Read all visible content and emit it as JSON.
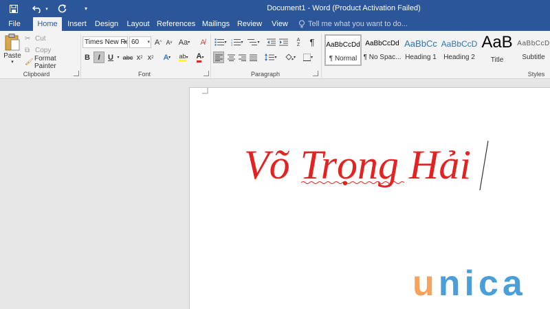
{
  "window": {
    "title": "Document1 - Word (Product Activation Failed)"
  },
  "tabs": {
    "file": "File",
    "home": "Home",
    "insert": "Insert",
    "design": "Design",
    "layout": "Layout",
    "references": "References",
    "mailings": "Mailings",
    "review": "Review",
    "view": "View",
    "tell_me": "Tell me what you want to do..."
  },
  "clipboard": {
    "paste": "Paste",
    "cut": "Cut",
    "copy": "Copy",
    "format_painter": "Format Painter",
    "label": "Clipboard"
  },
  "font": {
    "name": "Times New Ro",
    "size": "60",
    "grow": "A",
    "shrink": "A",
    "case": "Aa",
    "bold": "B",
    "italic": "I",
    "underline": "U",
    "strike": "abc",
    "subscript": "x",
    "superscript": "x",
    "sub_index": "2",
    "sup_index": "2",
    "text_effects": "A",
    "highlight": "ab",
    "font_color": "A",
    "label": "Font"
  },
  "paragraph": {
    "label": "Paragraph",
    "sort": "A Z",
    "pilcrow": "¶"
  },
  "styles": {
    "label": "Styles",
    "items": [
      {
        "sample": "AaBbCcDd",
        "name": "¶ Normal"
      },
      {
        "sample": "AaBbCcDd",
        "name": "¶ No Spac..."
      },
      {
        "sample": "AaBbCc",
        "name": "Heading 1"
      },
      {
        "sample": "AaBbCcD",
        "name": "Heading 2"
      },
      {
        "sample": "AaB",
        "name": "Title"
      },
      {
        "sample": "AaBbCcD",
        "name": "Subtitle"
      }
    ]
  },
  "document": {
    "text": "Võ Trọng Hải"
  },
  "watermark": {
    "u": "u",
    "nica": "nica"
  },
  "colors": {
    "brand": "#2b579a",
    "doc_text": "#e32222",
    "logo_orange": "#f7a35c",
    "logo_blue": "#4a9fd8"
  }
}
